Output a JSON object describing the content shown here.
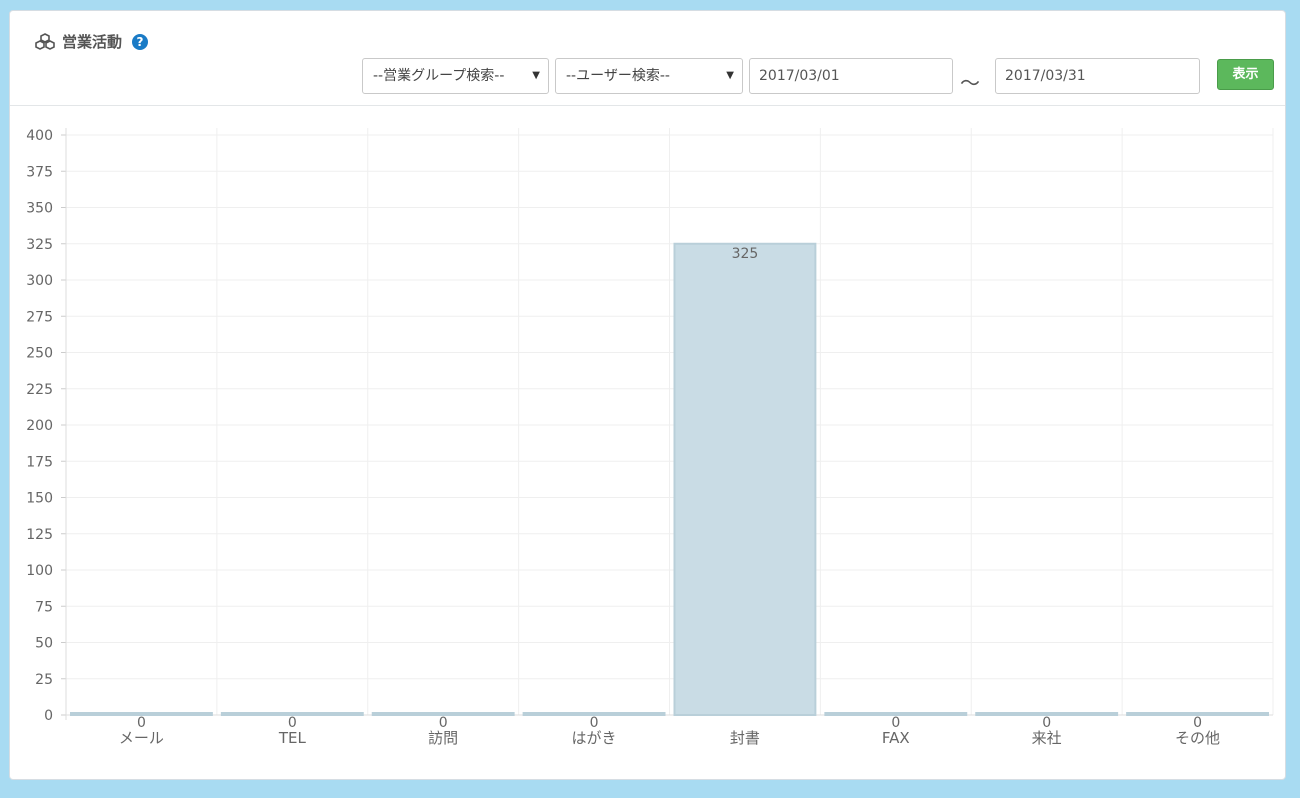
{
  "header": {
    "title": "営業活動",
    "help_icon": "question-circle-icon",
    "title_icon": "cubes-icon",
    "group_select": "--営業グループ検索--",
    "user_select": "--ユーザー検索--",
    "date_from": "2017/03/01",
    "date_separator": "～",
    "date_to": "2017/03/31",
    "show_button": "表示"
  },
  "colors": {
    "accent_button": "#5cb85c",
    "bar_fill": "#c9dce5",
    "bar_stroke": "#b9cfd9",
    "background": "#a8dbf2"
  },
  "chart_data": {
    "type": "bar",
    "categories": [
      "メール",
      "TEL",
      "訪問",
      "はがき",
      "封書",
      "FAX",
      "来社",
      "その他"
    ],
    "values": [
      0,
      0,
      0,
      0,
      325,
      0,
      0,
      0
    ],
    "data_labels": [
      "0",
      "0",
      "0",
      "0",
      "325",
      "0",
      "0",
      "0"
    ],
    "yticks": [
      0,
      25,
      50,
      75,
      100,
      125,
      150,
      175,
      200,
      225,
      250,
      275,
      300,
      325,
      350,
      375,
      400
    ],
    "ylim": [
      0,
      400
    ],
    "grid": true,
    "title": "",
    "xlabel": "",
    "ylabel": ""
  }
}
